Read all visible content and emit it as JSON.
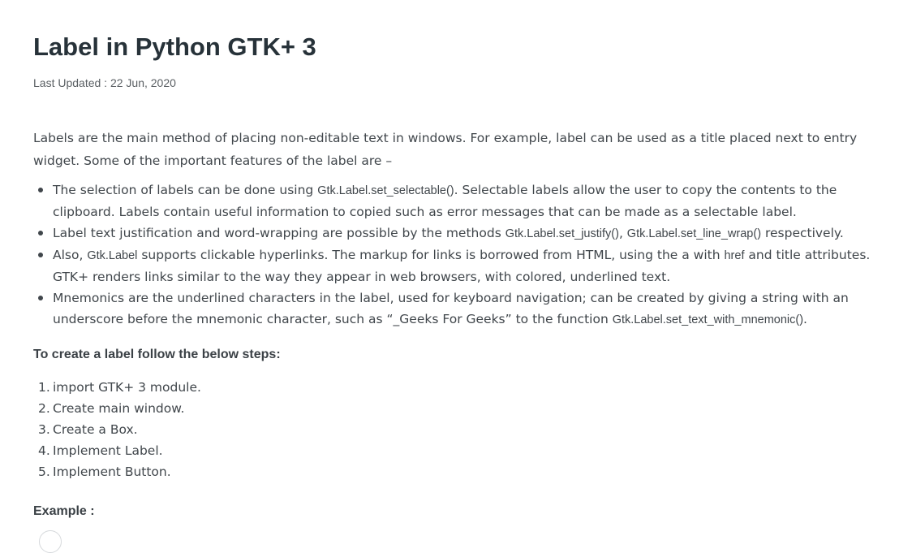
{
  "article": {
    "title": "Label in Python GTK+ 3",
    "last_updated": "Last Updated : 22 Jun, 2020",
    "intro": "Labels are the main method of placing non-editable text in windows. For example, label can be used as a title placed next to entry widget. Some of the important features of the label are –",
    "bullets": [
      {
        "a": "The selection of labels can be done using ",
        "code1": "Gtk.Label.set_selectable()",
        "b": ". Selectable labels allow the user to copy the contents to the clipboard. Labels contain useful information to copied such as error messages that can be made as a selectable label."
      },
      {
        "a": "Label text justification and word-wrapping are possible by the methods ",
        "code1": "Gtk.Label.set_justify()",
        "b": ", ",
        "code2": "Gtk.Label.set_line_wrap()",
        "c": " respectively."
      },
      {
        "a": "Also, ",
        "code1": "Gtk.Label",
        "b": " supports clickable hyperlinks. The markup for links is borrowed from HTML, using the a with ",
        "code2": "href",
        "c": " and title attributes. GTK+ renders links similar to the way they appear in web browsers, with colored, underlined text."
      },
      {
        "a": "Mnemonics are the underlined characters in the label, used for keyboard navigation; can be created by giving a string with an underscore before the mnemonic character, such as “_Geeks For Geeks” to the function ",
        "code1": "Gtk.Label.set_text_with_mnemonic()",
        "b": "."
      }
    ],
    "steps_heading": "To create a label follow the below steps:",
    "steps": [
      {
        "num": "1.",
        "text": "import GTK+ 3 module."
      },
      {
        "num": "2.",
        "text": "Create main window."
      },
      {
        "num": "3.",
        "text": "Create a Box."
      },
      {
        "num": "4.",
        "text": "Implement Label."
      },
      {
        "num": "5.",
        "text": "Implement Button."
      }
    ],
    "example_heading": "Example :"
  }
}
